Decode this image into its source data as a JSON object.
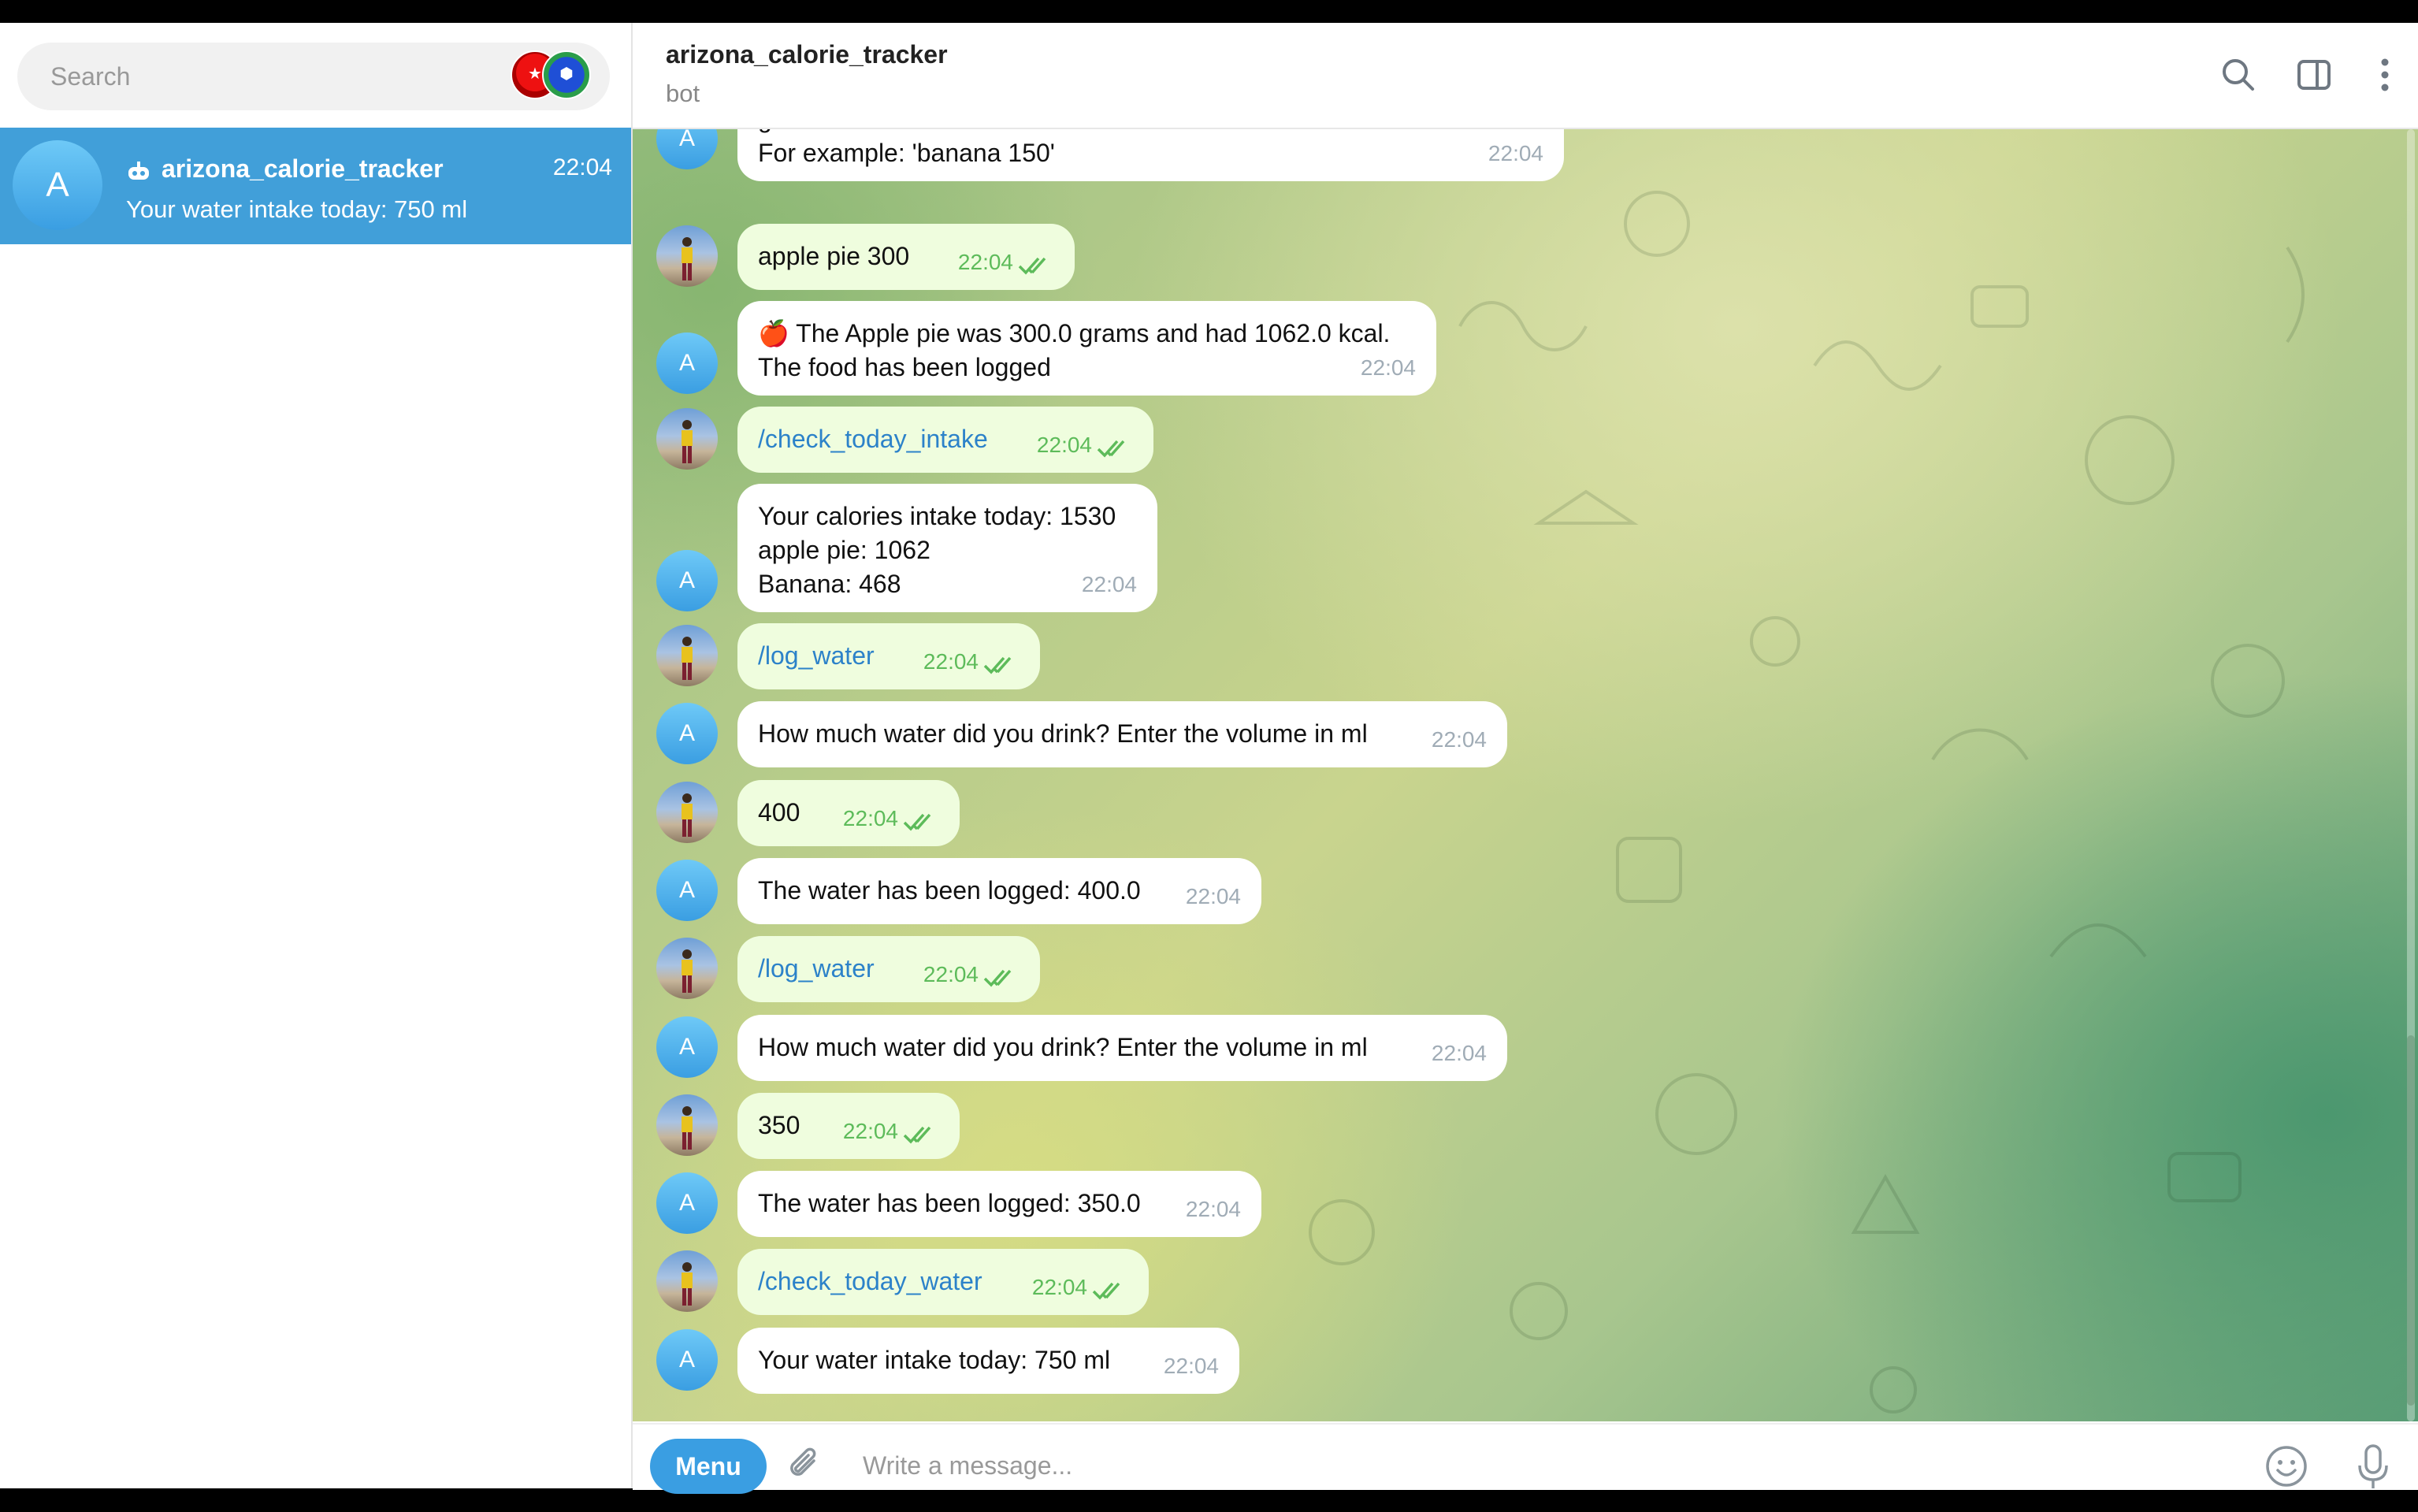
{
  "sidebar": {
    "search_placeholder": "Search",
    "chats": [
      {
        "avatar_letter": "A",
        "name": "arizona_calorie_tracker",
        "time": "22:04",
        "preview": "Your water intake today: 750 ml",
        "is_bot": true,
        "selected": true
      }
    ]
  },
  "header": {
    "title": "arizona_calorie_tracker",
    "subtitle": "bot",
    "icons": [
      "search-icon",
      "sidebar-toggle-icon",
      "more-vertical-icon"
    ]
  },
  "messages": [
    {
      "from": "bot",
      "lines": [
        "grams.",
        "For example: 'banana 150'"
      ],
      "time": "22:04"
    },
    {
      "from": "user",
      "text": "apple pie 300",
      "time": "22:04",
      "read": true
    },
    {
      "from": "bot",
      "emoji": "🍎",
      "lines": [
        "The Apple pie was 300.0 grams and had 1062.0 kcal.",
        "The food has been logged"
      ],
      "time": "22:04"
    },
    {
      "from": "user",
      "text": "/check_today_intake",
      "time": "22:04",
      "read": true,
      "command": true
    },
    {
      "from": "bot",
      "lines": [
        "Your calories intake today: 1530",
        "apple pie: 1062",
        "Banana: 468"
      ],
      "time": "22:04"
    },
    {
      "from": "user",
      "text": "/log_water",
      "time": "22:04",
      "read": true,
      "command": true
    },
    {
      "from": "bot",
      "lines": [
        "How much water did you drink? Enter the volume in ml"
      ],
      "time": "22:04"
    },
    {
      "from": "user",
      "text": "400",
      "time": "22:04",
      "read": true
    },
    {
      "from": "bot",
      "lines": [
        "The water has been logged: 400.0"
      ],
      "time": "22:04"
    },
    {
      "from": "user",
      "text": "/log_water",
      "time": "22:04",
      "read": true,
      "command": true
    },
    {
      "from": "bot",
      "lines": [
        "How much water did you drink? Enter the volume in ml"
      ],
      "time": "22:04"
    },
    {
      "from": "user",
      "text": "350",
      "time": "22:04",
      "read": true
    },
    {
      "from": "bot",
      "lines": [
        "The water has been logged: 350.0"
      ],
      "time": "22:04"
    },
    {
      "from": "user",
      "text": "/check_today_water",
      "time": "22:04",
      "read": true,
      "command": true
    },
    {
      "from": "bot",
      "lines": [
        "Your water intake today: 750 ml"
      ],
      "time": "22:04"
    }
  ],
  "bot_avatar_letter": "A",
  "composer": {
    "menu_label": "Menu",
    "placeholder": "Write a message..."
  },
  "colors": {
    "accent": "#419fd9",
    "outgoing_bubble": "#effdde",
    "incoming_bubble": "#ffffff",
    "read_ticks": "#5dbb5a",
    "command_link": "#2c82c9"
  }
}
